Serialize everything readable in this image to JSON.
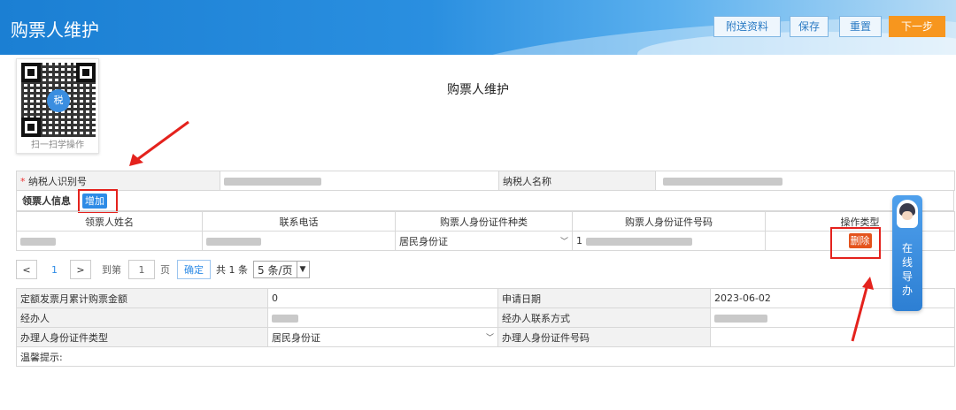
{
  "header": {
    "title": "购票人维护",
    "buttons": {
      "attachments": "附送资料",
      "save": "保存",
      "reset": "重置",
      "next": "下一步"
    },
    "accent": "#1b7fd3",
    "next_color": "#f7961e"
  },
  "qr": {
    "logo_text": "税",
    "caption": "扫一扫学操作"
  },
  "page_title": "购票人维护",
  "taxpayer": {
    "id_label": "纳税人识别号",
    "name_label": "纳税人名称"
  },
  "buyer_section": {
    "label": "领票人信息",
    "add_label": "增加"
  },
  "buyer_table": {
    "headers": [
      "领票人姓名",
      "联系电话",
      "购票人身份证件种类",
      "购票人身份证件号码",
      "操作类型"
    ],
    "row": {
      "id_type": "居民身份证",
      "id_prefix": "1",
      "delete_label": "删除"
    }
  },
  "pager": {
    "prev": "<",
    "current": "1",
    "next": ">",
    "goto_label": "到第",
    "goto_value": "1",
    "page_unit": "页",
    "confirm": "确定",
    "total": "共 1 条",
    "page_size": "5 条/页"
  },
  "details": {
    "quota_label": "定额发票月累计购票金额",
    "quota_value": "0",
    "apply_date_label": "申请日期",
    "apply_date_value": "2023-06-02",
    "agent_label": "经办人",
    "agent_contact_label": "经办人联系方式",
    "handler_id_type_label": "办理人身份证件类型",
    "handler_id_type_value": "居民身份证",
    "handler_id_no_label": "办理人身份证件号码",
    "tips_label": "温馨提示:"
  },
  "guide": {
    "text": "在线导办"
  },
  "icons": [
    "chevron-down-icon",
    "qr-code-icon",
    "assistant-avatar-icon",
    "red-arrow-annotation"
  ]
}
